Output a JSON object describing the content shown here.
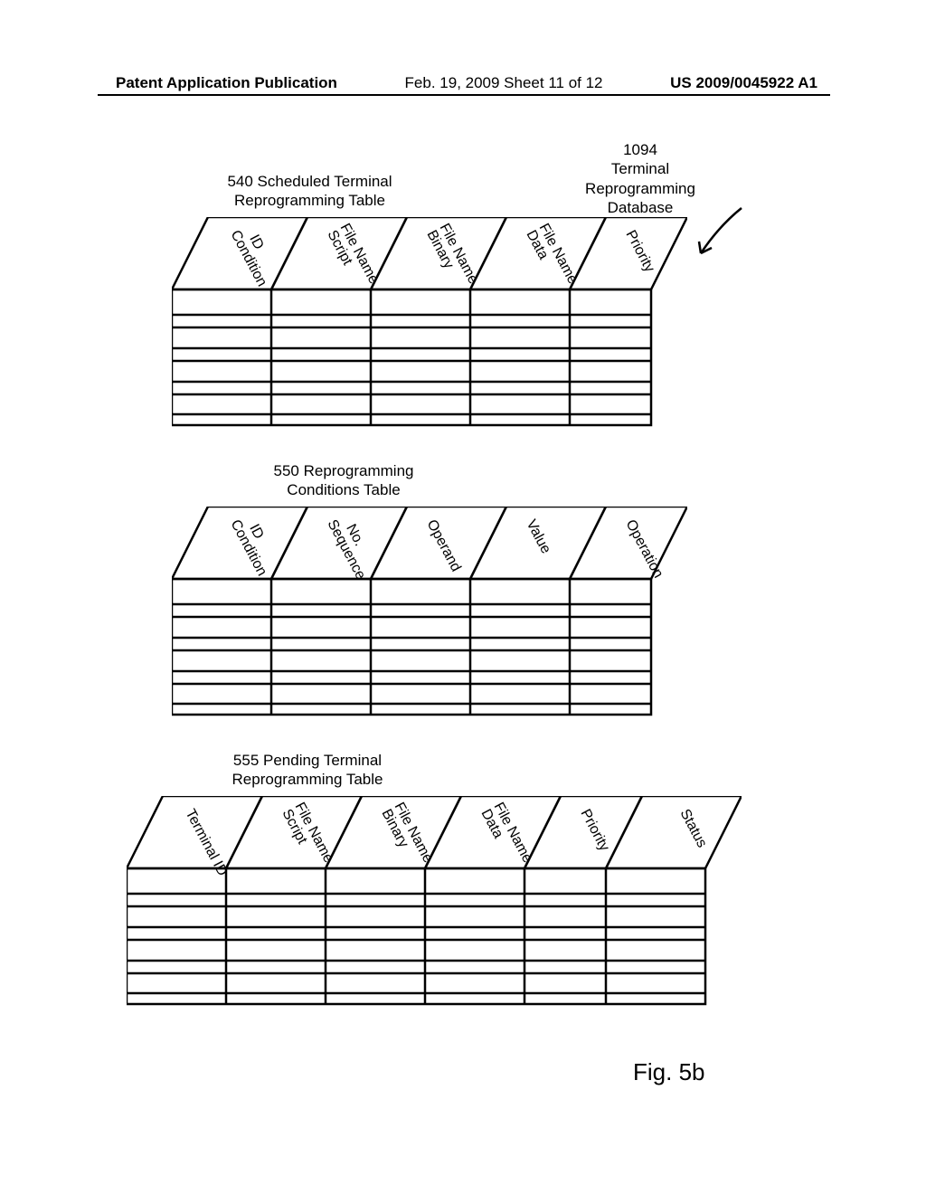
{
  "header": {
    "left": "Patent Application Publication",
    "center": "Feb. 19, 2009  Sheet 11 of 12",
    "right": "US 2009/0045922 A1"
  },
  "dbLabel": {
    "line1": "1094",
    "line2": "Terminal",
    "line3": "Reprogramming",
    "line4": "Database"
  },
  "tables": {
    "t1": {
      "title": "540 Scheduled Terminal\nReprogramming Table",
      "cols": [
        "Condition ID",
        "Script File Name",
        "Binary File Name",
        "Data File Name",
        "Priority"
      ]
    },
    "t2": {
      "title": "550 Reprogramming\nConditions Table",
      "cols": [
        "Condition ID",
        "Sequence No.",
        "Operand",
        "Value",
        "Operation"
      ]
    },
    "t3": {
      "title": "555 Pending Terminal\nReprogramming Table",
      "cols": [
        "Terminal ID",
        "Script File Name",
        "Binary File Name",
        "Data File Name",
        "Priority",
        "Status"
      ]
    }
  },
  "figureLabel": "Fig. 5b"
}
